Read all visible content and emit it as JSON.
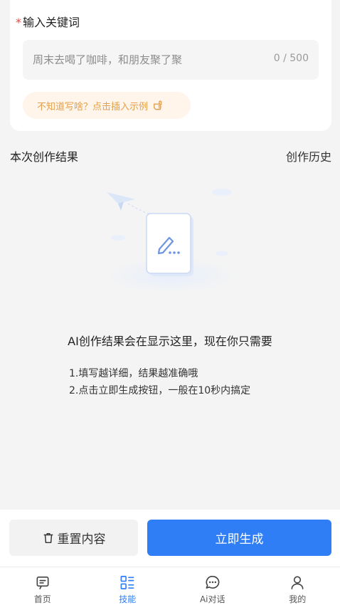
{
  "form": {
    "required_mark": "*",
    "keyword_label": "输入关键词",
    "keyword_value": "周末去喝了咖啡，和朋友聚了聚",
    "char_count": "0 / 500",
    "example_hint": "不知道写啥？点击插入示例"
  },
  "results": {
    "title": "本次创作结果",
    "history_link": "创作历史",
    "empty_title": "AI创作结果会在显示这里，现在你只需要",
    "tips": [
      "1.填写越详细，结果越准确哦",
      "2.点击立即生成按钮，一般在10秒内搞定"
    ]
  },
  "actions": {
    "reset_label": "重置内容",
    "generate_label": "立即生成"
  },
  "tabs": [
    {
      "label": "首页",
      "icon": "home-icon",
      "active": false
    },
    {
      "label": "技能",
      "icon": "skills-icon",
      "active": true
    },
    {
      "label": "Ai对话",
      "icon": "chat-icon",
      "active": false
    },
    {
      "label": "我的",
      "icon": "profile-icon",
      "active": false
    }
  ],
  "colors": {
    "primary": "#2f7ef5",
    "required": "#e5483b",
    "hint": "#e4a04d"
  }
}
